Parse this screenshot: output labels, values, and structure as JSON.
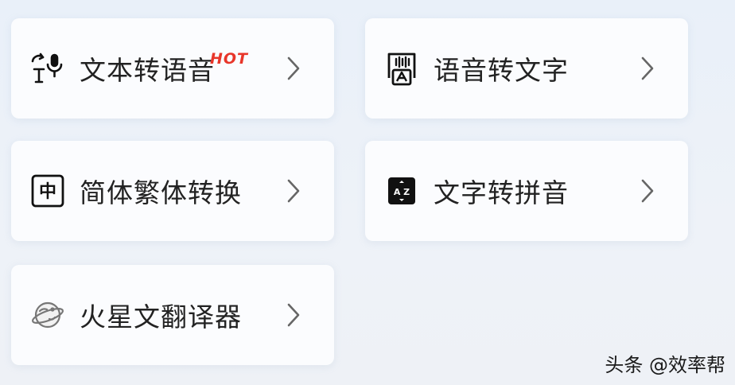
{
  "cards": [
    {
      "label": "文本转语音",
      "icon": "text-to-speech-icon",
      "badge": "HOT"
    },
    {
      "label": "语音转文字",
      "icon": "speech-to-text-icon"
    },
    {
      "label": "简体繁体转换",
      "icon": "chinese-char-icon",
      "icon_text": "中"
    },
    {
      "label": "文字转拼音",
      "icon": "az-pinyin-icon",
      "icon_text": "A Z"
    },
    {
      "label": "火星文翻译器",
      "icon": "planet-icon"
    }
  ],
  "watermark": "头条 @效率帮",
  "colors": {
    "badge": "#e8362a",
    "text": "#222222",
    "chevron": "#666666"
  }
}
